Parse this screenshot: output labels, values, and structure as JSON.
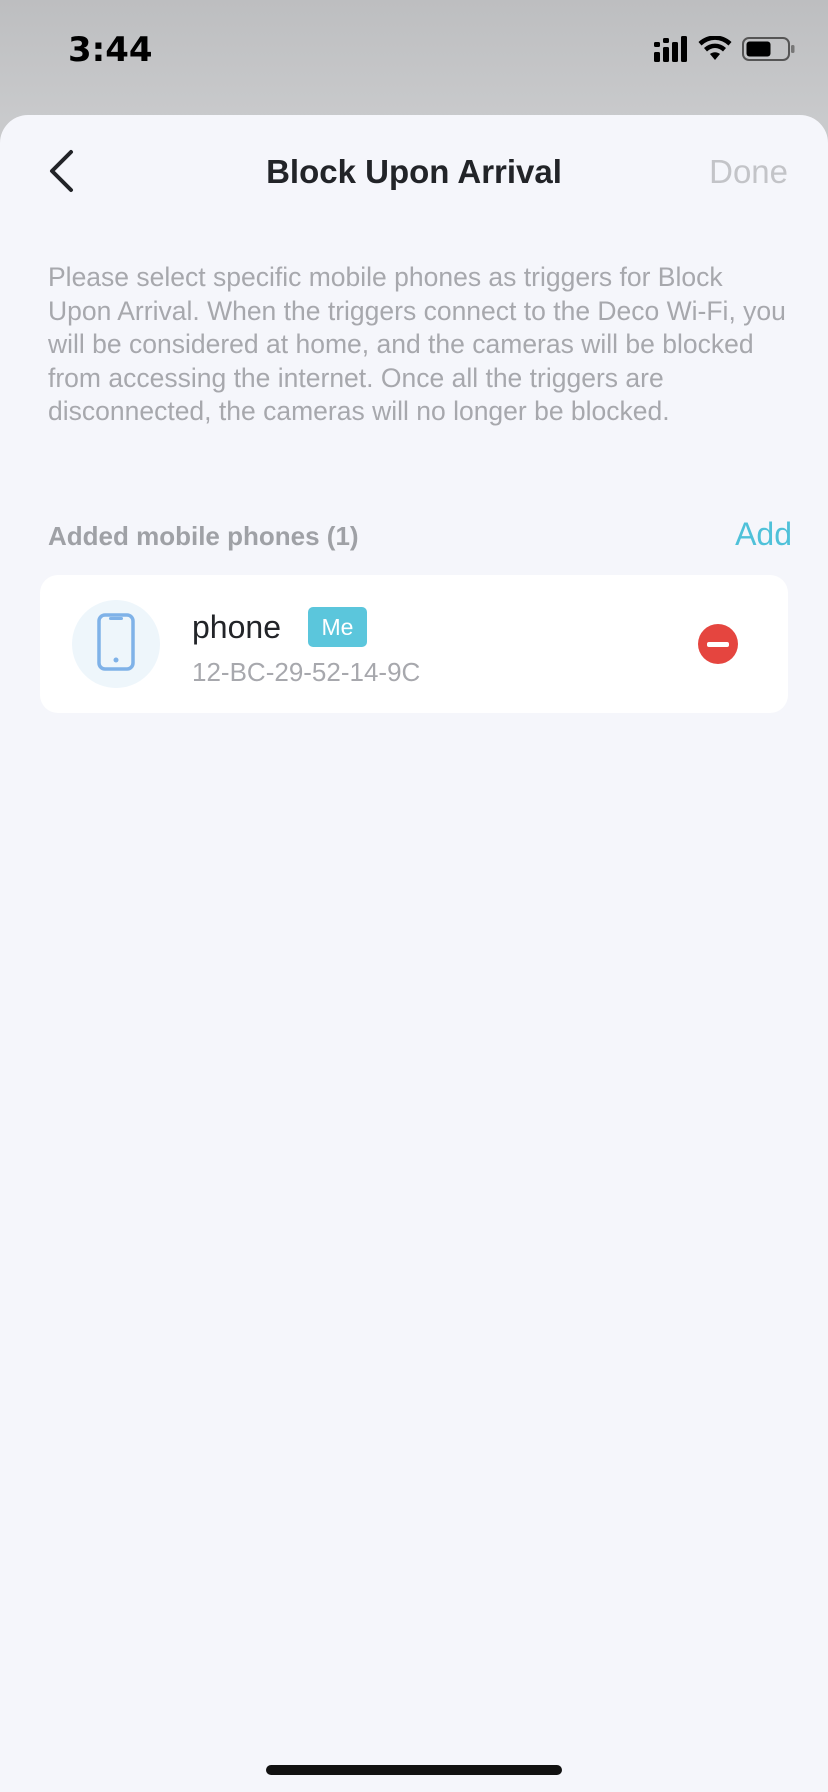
{
  "status_bar": {
    "time": "3:44",
    "icons": [
      "signal-icon",
      "wifi-icon",
      "battery-icon"
    ]
  },
  "nav": {
    "back_icon": "chevron-left-icon",
    "title": "Block Upon Arrival",
    "done_label": "Done"
  },
  "description": "Please select specific mobile phones as triggers for Block Upon Arrival. When the triggers connect to the Deco Wi-Fi, you will be considered at home, and the cameras will be blocked from accessing the internet. Once all the triggers are disconnected, the cameras will no longer be blocked.",
  "section": {
    "header": "Added mobile phones (1)",
    "add_label": "Add"
  },
  "devices": [
    {
      "icon": "smartphone-icon",
      "name": "phone",
      "badge": "Me",
      "mac": "12-BC-29-52-14-9C",
      "action_icon": "remove-icon"
    }
  ],
  "colors": {
    "accent": "#4fc1d9",
    "badge": "#5bc6dc",
    "remove": "#e5453f",
    "background": "#f5f6fb",
    "muted_text": "#a7a8ad"
  }
}
